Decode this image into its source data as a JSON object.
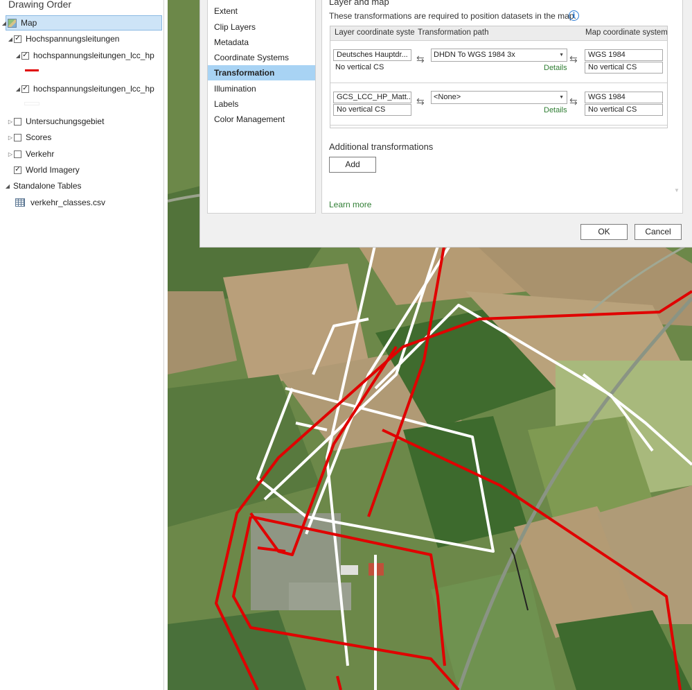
{
  "toc": {
    "title": "Drawing Order",
    "map": "Map",
    "layer_group": "Hochspannungsleitungen",
    "sublayer_1": "hochspannungsleitungen_lcc_hp",
    "sublayer_2": "hochspannungsleitungen_lcc_hp",
    "layers": [
      "Untersuchungsgebiet",
      "Scores",
      "Verkehr",
      "World Imagery"
    ],
    "standalone_tables": "Standalone Tables",
    "table": "verkehr_classes.csv",
    "symbol_colors": {
      "sublayer_1": "#e00000",
      "sublayer_2": "#ffffff"
    }
  },
  "dialog": {
    "nav": [
      "Extent",
      "Clip Layers",
      "Metadata",
      "Coordinate Systems",
      "Transformation",
      "Illumination",
      "Labels",
      "Color Management"
    ],
    "active_nav": "Transformation",
    "section_title": "Layer and map",
    "description": "These transformations are required to position datasets in the map.",
    "columns": {
      "layer_cs": "Layer coordinate system",
      "path": "Transformation path",
      "map_cs": "Map coordinate system"
    },
    "rows": [
      {
        "layer_cs": "Deutsches Hauptdr...",
        "layer_vcs": "No vertical CS",
        "path": "DHDN To WGS 1984 3x",
        "details": "Details",
        "map_cs": "WGS 1984",
        "map_vcs": "No vertical CS"
      },
      {
        "layer_cs": "GCS_LCC_HP_Matt...",
        "layer_vcs": "No vertical CS",
        "path": "<None>",
        "details": "Details",
        "map_cs": "WGS 1984",
        "map_vcs": "No vertical CS"
      }
    ],
    "additional_title": "Additional transformations",
    "add_button": "Add",
    "learn_more": "Learn more",
    "ok": "OK",
    "cancel": "Cancel"
  }
}
